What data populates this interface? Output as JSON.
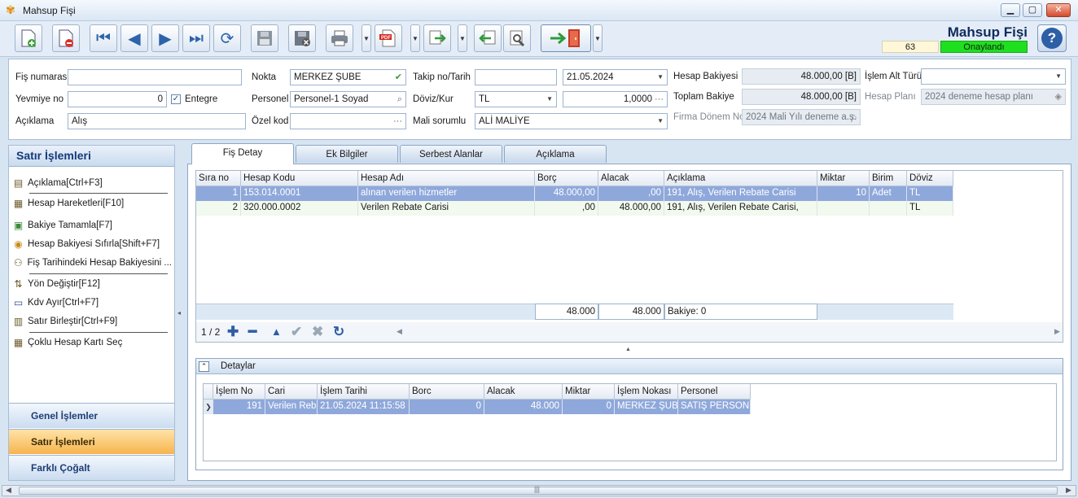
{
  "window": {
    "title": "Mahsup Fişi",
    "min": "▁",
    "max": "▢",
    "close": "✕"
  },
  "header": {
    "title": "Mahsup Fişi",
    "record_no": "63",
    "status": "Onaylandı",
    "status_color": "#1ee01e",
    "help": "?"
  },
  "toolbar": {
    "icons": [
      "new-document-icon",
      "delete-document-icon",
      "first-record-icon",
      "previous-record-icon",
      "next-record-icon",
      "last-record-icon",
      "refresh-icon",
      "save-icon",
      "cancel-save-icon",
      "print-icon",
      "pdf-icon",
      "export-icon",
      "import-icon",
      "settings-icon",
      "exit-icon"
    ]
  },
  "form": {
    "fis_numarasi": {
      "label": "Fiş numarası",
      "value": ""
    },
    "yevmiye_no": {
      "label": "Yevmiye no",
      "value": "0"
    },
    "entegre": {
      "label": "Entegre",
      "checked": true
    },
    "aciklama": {
      "label": "Açıklama",
      "value": "Alış"
    },
    "nokta": {
      "label": "Nokta",
      "value": "MERKEZ ŞUBE"
    },
    "personel": {
      "label": "Personel",
      "value": "Personel-1 Soyad"
    },
    "ozel_kod": {
      "label": "Özel kod",
      "value": ""
    },
    "takip_no": {
      "label": "Takip no/Tarih",
      "value": "",
      "date": "21.05.2024"
    },
    "doviz_kur": {
      "label": "Döviz/Kur",
      "currency": "TL",
      "rate": "1,0000"
    },
    "mali_sorumlu": {
      "label": "Mali sorumlu",
      "value": "ALİ MALİYE"
    },
    "hesap_bakiyesi": {
      "label": "Hesap Bakiyesi",
      "value": "48.000,00 [B]"
    },
    "toplam_bakiye": {
      "label": "Toplam Bakiye",
      "value": "48.000,00 [B]"
    },
    "firma_donem": {
      "label": "Firma Dönem No",
      "value": "2024 Mali Yılı deneme a.ş."
    },
    "islem_alt_turu": {
      "label": "İşlem Alt Türü",
      "value": ""
    },
    "hesap_plani": {
      "label": "Hesap Planı",
      "value": "2024 deneme hesap planı"
    }
  },
  "left_panel": {
    "title": "Satır İşlemleri",
    "items": [
      "Açıklama[Ctrl+F3]",
      "Hesap Hareketleri[F10]",
      "Bakiye Tamamla[F7]",
      "Hesap Bakiyesi Sıfırla[Shift+F7]",
      "Fiş Tarihindeki Hesap Bakiyesini ...",
      "Yön Değiştir[F12]",
      "Kdv Ayır[Ctrl+F7]",
      "Satır Birleştir[Ctrl+F9]",
      "Çoklu Hesap Kartı Seç"
    ],
    "sections": [
      "Genel İşlemler",
      "Satır İşlemleri",
      "Farklı Çoğalt"
    ]
  },
  "tabs": [
    "Fiş Detay",
    "Ek Bilgiler",
    "Serbest Alanlar",
    "Açıklama"
  ],
  "grid": {
    "headers": [
      "Sıra no",
      "Hesap Kodu",
      "Hesap Adı",
      "Borç",
      "Alacak",
      "Açıklama",
      "Miktar",
      "Birim",
      "Döviz"
    ],
    "rows": [
      [
        "1",
        "153.014.0001",
        "alınan verilen hizmetler",
        "48.000,00",
        ",00",
        "191, Alış, Verilen Rebate Carisi",
        "10",
        "Adet",
        "TL"
      ],
      [
        "2",
        "320.000.0002",
        "Verilen Rebate Carisi",
        ",00",
        "48.000,00",
        "191, Alış, Verilen Rebate Carisi,",
        "",
        "",
        "TL"
      ]
    ],
    "totals": {
      "borc": "48.000",
      "alacak": "48.000",
      "bakiye": "Bakiye: 0"
    },
    "nav": "1 / 2"
  },
  "details": {
    "title": "Detaylar",
    "headers": [
      "İşlem No",
      "Cari",
      "İşlem Tarihi",
      "Borc",
      "Alacak",
      "Miktar",
      "İşlem Nokası",
      "Personel"
    ],
    "rows": [
      [
        "191",
        "Verilen Rebate",
        "21.05.2024 11:15:58",
        "0",
        "48.000",
        "0",
        "MERKEZ ŞUBE",
        "SATIŞ PERSONE"
      ]
    ]
  }
}
